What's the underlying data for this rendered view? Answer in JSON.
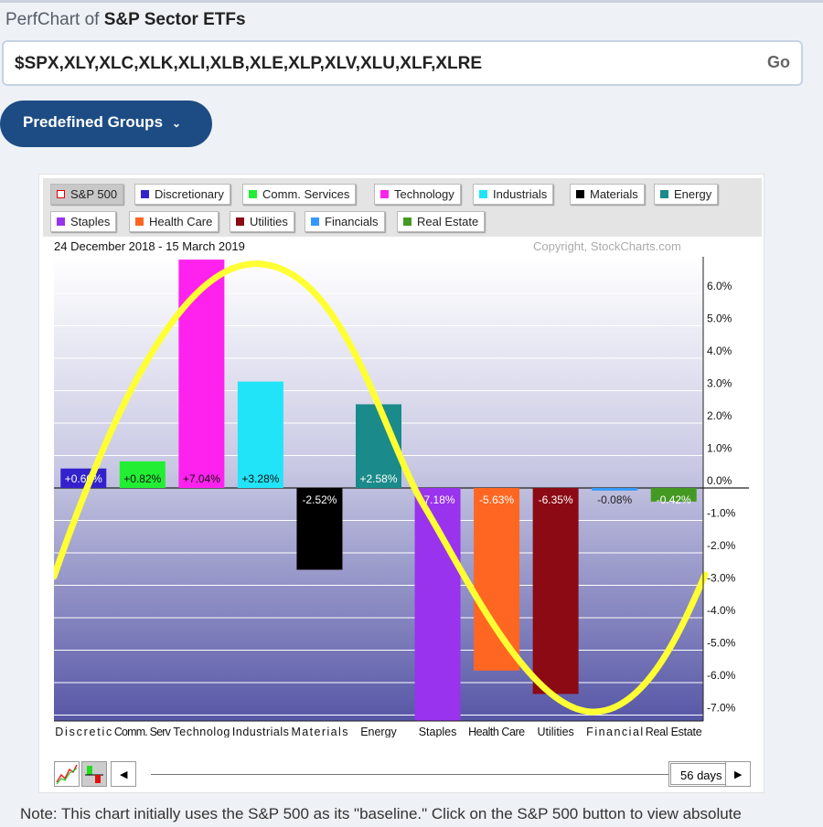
{
  "header": {
    "title_prefix": "PerfChart of",
    "title_main": "S&P Sector ETFs"
  },
  "symbols_input": {
    "value": "$SPX,XLY,XLC,XLK,XLI,XLB,XLE,XLP,XLV,XLU,XLF,XLRE",
    "go_label": "Go"
  },
  "predefined_groups_label": "Predefined Groups",
  "legend": [
    {
      "label": "S&P 500",
      "color": "#ffffff",
      "border": "#e00000",
      "selected": true
    },
    {
      "label": "Discretionary",
      "color": "#3322cc"
    },
    {
      "label": "Comm. Services",
      "color": "#22ee33"
    },
    {
      "label": "Technology",
      "color": "#ff22ee"
    },
    {
      "label": "Industrials",
      "color": "#22e4f8"
    },
    {
      "label": "Materials",
      "color": "#000000"
    },
    {
      "label": "Energy",
      "color": "#1a8a8a"
    },
    {
      "label": "Staples",
      "color": "#9933ee"
    },
    {
      "label": "Health Care",
      "color": "#ff6622"
    },
    {
      "label": "Utilities",
      "color": "#8b0a14"
    },
    {
      "label": "Financials",
      "color": "#3399ff"
    },
    {
      "label": "Real Estate",
      "color": "#449922"
    }
  ],
  "date_range": "24 December 2018 - 15 March 2019",
  "copyright": "Copyright, StockCharts.com",
  "chart_data": {
    "type": "bar",
    "categories": [
      "Discretic",
      "Comm. Serv",
      "Technolog",
      "Industrials",
      "Materials",
      "Energy",
      "Staples",
      "Health Care",
      "Utilities",
      "Financial",
      "Real Estate"
    ],
    "values": [
      0.6,
      0.82,
      7.04,
      3.28,
      -2.52,
      2.58,
      -7.18,
      -5.63,
      -6.35,
      -0.08,
      -0.42
    ],
    "value_labels": [
      "+0.60%",
      "+0.82%",
      "+7.04%",
      "+3.28%",
      "-2.52%",
      "+2.58%",
      "-7.18%",
      "-5.63%",
      "-6.35%",
      "-0.08%",
      "-0.42%"
    ],
    "colors": [
      "#3322cc",
      "#22ee33",
      "#ff22ee",
      "#22e4f8",
      "#000000",
      "#1a8a8a",
      "#9933ee",
      "#ff6622",
      "#8b0a14",
      "#3399ff",
      "#449922"
    ],
    "label_colors": [
      "#fff",
      "#111",
      "#111",
      "#111",
      "#fff",
      "#fff",
      "#fff",
      "#fff",
      "#fff",
      "#222",
      "#fff"
    ],
    "yticks": [
      6,
      5,
      4,
      3,
      2,
      1,
      0,
      -1,
      -2,
      -3,
      -4,
      -5,
      -6,
      -7
    ],
    "ytick_labels": [
      "6.0%",
      "5.0%",
      "4.0%",
      "3.0%",
      "2.0%",
      "1.0%",
      "0.0%",
      "-1.0%",
      "-2.0%",
      "-3.0%",
      "-4.0%",
      "-5.0%",
      "-6.0%",
      "-7.0%"
    ],
    "ylim": [
      -7.18,
      7.1
    ],
    "baseline": "S&P 500"
  },
  "nav": {
    "period": "56 days"
  },
  "note": "Note: This chart initially uses the S&P 500 as its \"baseline.\" Click on the S&P 500 button to view absolute"
}
